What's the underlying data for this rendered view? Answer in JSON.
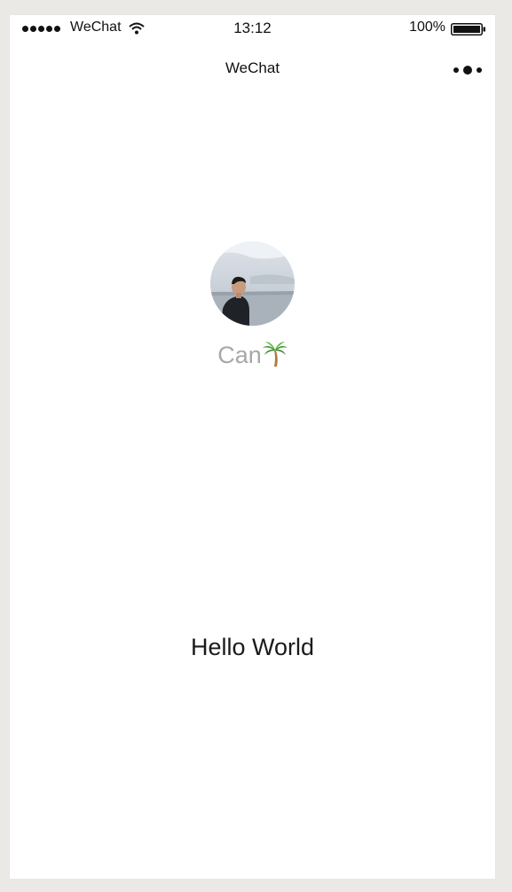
{
  "status_bar": {
    "carrier": "WeChat",
    "time": "13:12",
    "battery": "100%"
  },
  "nav": {
    "title": "WeChat"
  },
  "user": {
    "nickname": "Can"
  },
  "content": {
    "motto": "Hello World"
  },
  "icons": {
    "signal": "signal-dots-icon",
    "wifi": "wifi-icon",
    "battery": "battery-icon",
    "menu": "more-menu-icon",
    "palm_tree": "palm-tree-icon"
  },
  "colors": {
    "page_background": "#ebe9e5",
    "screen_background": "#ffffff",
    "nickname_text": "#a8a8a8",
    "body_text": "#1a1a1a"
  }
}
